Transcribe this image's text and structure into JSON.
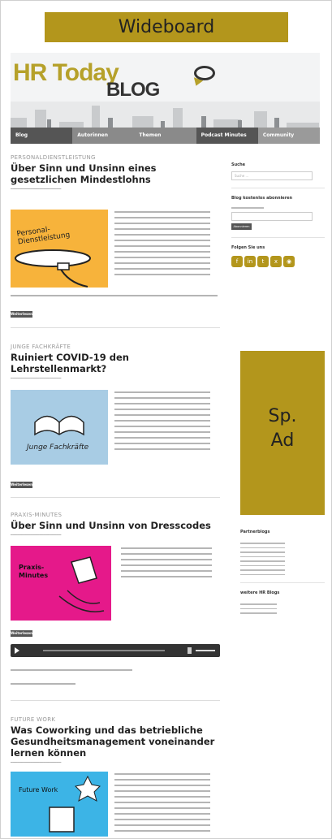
{
  "wideboard_label": "Wideboard",
  "ad_label": "Sp.\nAd",
  "ad_line1": "Sp.",
  "ad_line2": "Ad",
  "logo": {
    "line1": "HR Today",
    "line2": "BLOG"
  },
  "nav": {
    "items": [
      "Blog",
      "Autorinnen",
      "Themen",
      "Podcast Minutes",
      "Community"
    ]
  },
  "colors": {
    "accent": "#b3961c",
    "nav_bg": "#555555",
    "nav_active": "#8a8a8a"
  },
  "posts": [
    {
      "kicker": "PERSONALDIENSTLEISTUNG",
      "title": "Über Sinn und Unsinn eines gesetzlichen Mindestlohns",
      "button": "Weiterlesen",
      "thumb_text": "Personal-Dienstleistung",
      "thumb_color": "#f7b33b"
    },
    {
      "kicker": "JUNGE FACHKRÄFTE",
      "title": "Ruiniert COVID-19 den Lehrstellenmarkt?",
      "button": "Weiterlesen",
      "thumb_text": "Junge Fachkräfte",
      "thumb_color": "#a8cce4"
    },
    {
      "kicker": "PRAXIS-MINUTES",
      "title": "Über Sinn und Unsinn von Dresscodes",
      "button": "Weiterlesen",
      "thumb_text": "Praxis-Minutes",
      "thumb_color": "#e5198a"
    },
    {
      "kicker": "FUTURE WORK",
      "title": "Was Coworking und das betriebliche Gesundheitsmanagement voneinander lernen können",
      "button": "Weiterlesen",
      "thumb_text": "Future Work",
      "thumb_color": "#3cb4e6"
    }
  ],
  "sidebar": {
    "search_title": "Suche",
    "search_placeholder": "Suche ...",
    "subscribe_title": "Blog kostenlos abonnieren",
    "subscribe_button": "Abonnieren",
    "follow_title": "Folgen Sie uns",
    "partner_title": "Partnerblogs",
    "more_title": "weitere HR Blogs"
  },
  "social_icons": [
    "facebook-icon",
    "linkedin-icon",
    "twitter-icon",
    "xing-icon",
    "rss-icon"
  ]
}
